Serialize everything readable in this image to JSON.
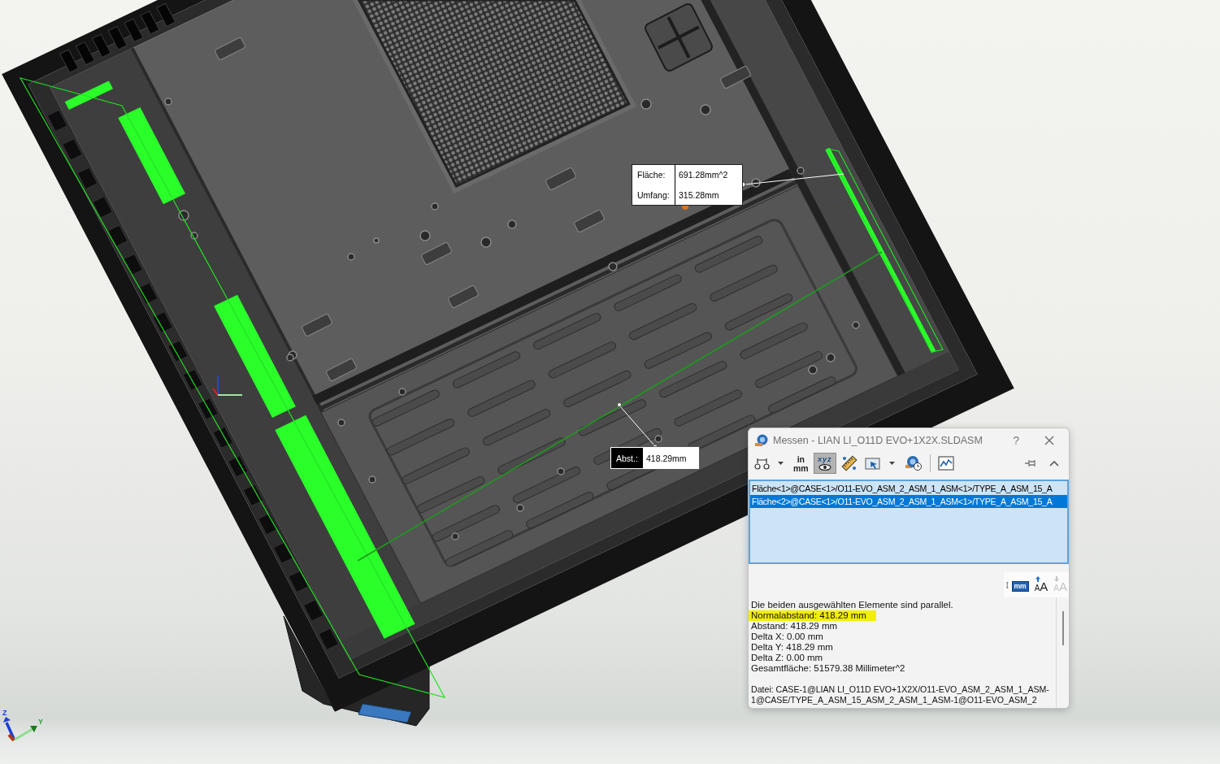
{
  "viewport": {
    "callouts": [
      {
        "kind": "plain",
        "rows": [
          {
            "label": "Fläche:",
            "value": "691.28mm^2"
          },
          {
            "label": "Umfang:",
            "value": "315.28mm"
          }
        ]
      },
      {
        "kind": "inverted",
        "rows": [
          {
            "label": "Abst.:",
            "value": "418.29mm"
          }
        ]
      }
    ],
    "axis_labels": [
      "Z",
      "Y"
    ]
  },
  "dialog": {
    "title": "Messen - LIAN LI_O11D EVO+1X2X.SLDASM",
    "help": "?",
    "toolbar": [
      {
        "kind": "dimension",
        "dropdown": true,
        "selected": false
      },
      {
        "kind": "units",
        "text": [
          "in",
          "mm"
        ],
        "dropdown": false,
        "selected": false
      },
      {
        "kind": "xyz",
        "text": "xyz",
        "dropdown": false,
        "selected": true
      },
      {
        "kind": "ruler",
        "dropdown": false,
        "selected": false
      },
      {
        "kind": "select",
        "dropdown": true,
        "selected": false
      },
      {
        "kind": "history",
        "dropdown": false,
        "selected": false
      },
      {
        "kind": "separator"
      },
      {
        "kind": "chart",
        "dropdown": false,
        "selected": false
      }
    ],
    "selections": [
      {
        "text": "Fläche<1>@CASE<1>/O11-EVO_ASM_2_ASM_1_ASM<1>/TYPE_A_ASM_15_A",
        "selected": false
      },
      {
        "text": "Fläche<2>@CASE<1>/O11-EVO_ASM_2_ASM_1_ASM<1>/TYPE_A_ASM_15_A",
        "selected": true
      }
    ],
    "result_tools": [
      {
        "kind": "units",
        "label": "mm",
        "disabled": false
      },
      {
        "kind": "font-up",
        "label": "AA",
        "disabled": false
      },
      {
        "kind": "font-down",
        "label": "AA",
        "disabled": true
      }
    ],
    "results": [
      {
        "lines": [
          {
            "text": "Die beiden ausgewählten Elemente sind parallel.",
            "highlighted": false
          },
          {
            "text": "Normalabstand: 418.29 mm",
            "highlighted": true
          },
          {
            "text": "Abstand: 418.29 mm",
            "highlighted": false
          },
          {
            "text": "Delta X: 0.00 mm",
            "highlighted": false
          },
          {
            "text": "Delta Y: 418.29 mm",
            "highlighted": false
          },
          {
            "text": "Delta Z: 0.00 mm",
            "highlighted": false
          },
          {
            "text": "Gesamtfläche: 51579.38 Millimeter^2",
            "highlighted": false
          }
        ]
      },
      {
        "lines": [
          {
            "text": "Datei: CASE-1@LIAN LI_O11D EVO+1X2X/O11-EVO_ASM_2_ASM_1_ASM-1@CASE/TYPE_A_ASM_15_ASM_2_ASM_1_ASM-1@O11-EVO_ASM_2",
            "highlighted": false
          }
        ]
      }
    ]
  }
}
